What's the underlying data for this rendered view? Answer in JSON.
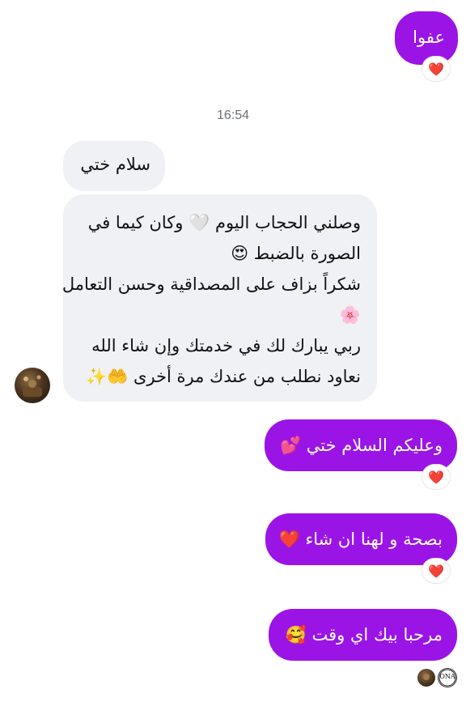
{
  "messages": {
    "sent_1": {
      "text": "عفوا",
      "reaction": "❤️"
    },
    "timestamp": "16:54",
    "received_1": {
      "text": "سلام ختي"
    },
    "received_2": {
      "lines": [
        "وصلني الحجاب اليوم 🤍 وكان كيما في",
        "الصورة بالضبط 😍",
        "شكراً بزاف على المصداقية وحسن التعامل",
        "🌸",
        "ربي يبارك لك في خدمتك وإن شاء الله",
        "نعاود نطلب من عندك مرة أخرى 🤲✨"
      ]
    },
    "sent_2": {
      "text": "وعليكم السلام ختي 💕",
      "reaction": "❤️"
    },
    "sent_3": {
      "text": "بصحة و لهنا ان شاء ❤️",
      "reaction": "❤️"
    },
    "sent_4": {
      "text": "مرحبا بيك اي وقت 🥰"
    }
  },
  "seen_avatars": {
    "logo_text": "ONA"
  },
  "colors": {
    "sent_bubble": "#9b14e6",
    "received_bubble": "#f0f1f5",
    "heart": "#e0152c"
  }
}
